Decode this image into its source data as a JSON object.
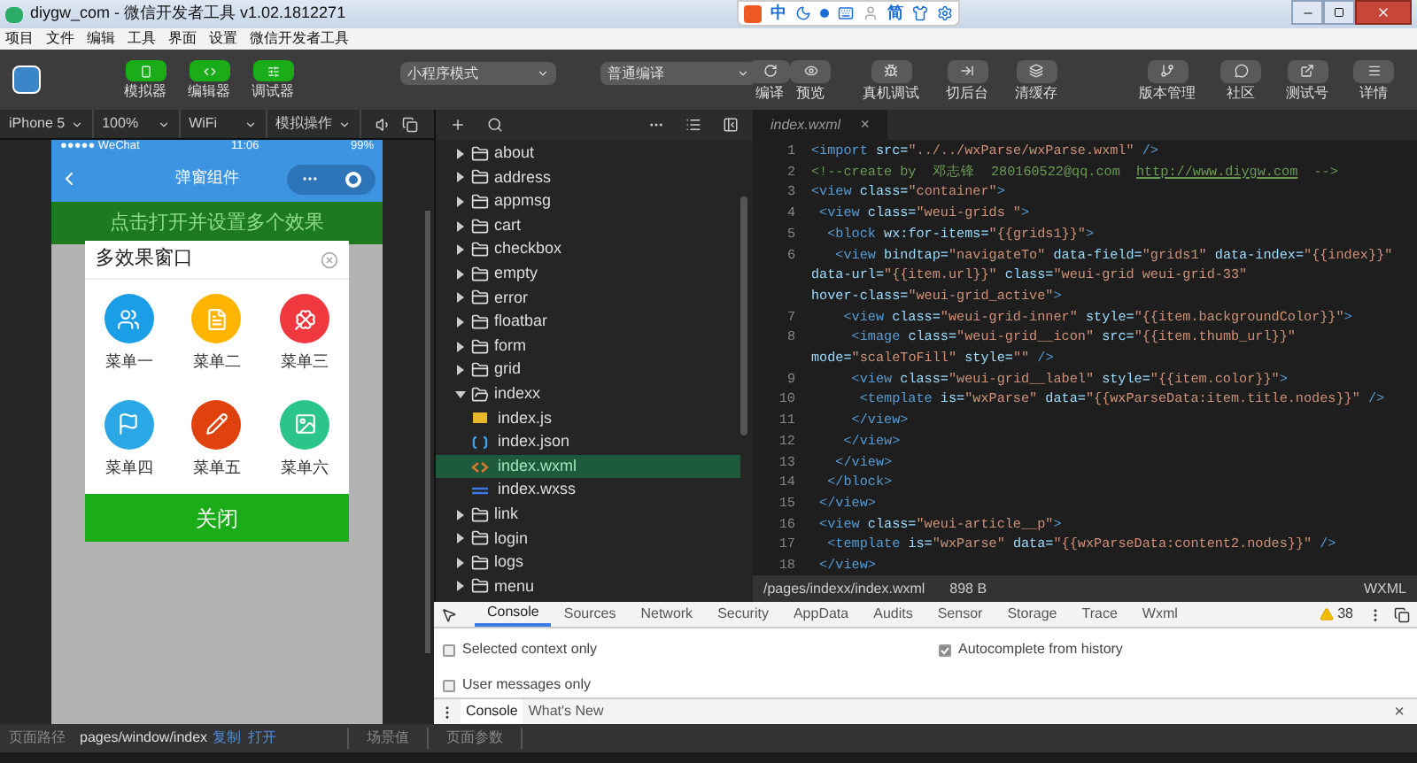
{
  "title_bar": {
    "title": "diygw_com - 微信开发者工具 v1.02.1812271"
  },
  "ime_toolbar": {
    "mode": "中",
    "script": "简"
  },
  "menu_bar": [
    "项目",
    "文件",
    "编辑",
    "工具",
    "界面",
    "设置",
    "微信开发者工具"
  ],
  "toolbar": {
    "views": [
      {
        "label": "模拟器",
        "kind": "simulator"
      },
      {
        "label": "编辑器",
        "kind": "editor"
      },
      {
        "label": "调试器",
        "kind": "debugger"
      }
    ],
    "mode_select": "小程序模式",
    "compile_select": "普通编译",
    "actions": [
      {
        "label": "编译",
        "kind": "compile"
      },
      {
        "label": "预览",
        "kind": "preview"
      },
      {
        "label": "真机调试",
        "kind": "device"
      },
      {
        "label": "切后台",
        "kind": "background"
      },
      {
        "label": "清缓存",
        "kind": "cache"
      }
    ],
    "right_actions": [
      {
        "label": "版本管理",
        "kind": "version"
      },
      {
        "label": "社区",
        "kind": "community"
      },
      {
        "label": "测试号",
        "kind": "testid"
      },
      {
        "label": "详情",
        "kind": "details"
      }
    ]
  },
  "simulator": {
    "device": "iPhone 5",
    "zoom": "100%",
    "network": "WiFi",
    "operation": "模拟操作",
    "status_bar": {
      "carrier": "●●●●● WeChat",
      "time": "11:06",
      "battery": "99%"
    },
    "nav_title": "弹窗组件",
    "banner": "点击打开并设置多个效果",
    "modal": {
      "title": "多效果窗口",
      "items": [
        {
          "label": "菜单一",
          "color": "#1a9ee8",
          "kind": "people"
        },
        {
          "label": "菜单二",
          "color": "#ffb400",
          "kind": "note"
        },
        {
          "label": "菜单三",
          "color": "#f0393f",
          "kind": "clover"
        },
        {
          "label": "菜单四",
          "color": "#29a8e5",
          "kind": "flag"
        },
        {
          "label": "菜单五",
          "color": "#e0420e",
          "kind": "pen"
        },
        {
          "label": "菜单六",
          "color": "#2bc48a",
          "kind": "image"
        }
      ],
      "close_button": "关闭"
    }
  },
  "file_tree": [
    {
      "name": "about",
      "kind": "folder",
      "expanded": false,
      "selected": false
    },
    {
      "name": "address",
      "kind": "folder",
      "expanded": false,
      "selected": false
    },
    {
      "name": "appmsg",
      "kind": "folder",
      "expanded": false,
      "selected": false
    },
    {
      "name": "cart",
      "kind": "folder",
      "expanded": false,
      "selected": false
    },
    {
      "name": "checkbox",
      "kind": "folder",
      "expanded": false,
      "selected": false
    },
    {
      "name": "empty",
      "kind": "folder",
      "expanded": false,
      "selected": false
    },
    {
      "name": "error",
      "kind": "folder",
      "expanded": false,
      "selected": false
    },
    {
      "name": "floatbar",
      "kind": "folder",
      "expanded": false,
      "selected": false
    },
    {
      "name": "form",
      "kind": "folder",
      "expanded": false,
      "selected": false
    },
    {
      "name": "grid",
      "kind": "folder",
      "expanded": false,
      "selected": false
    },
    {
      "name": "indexx",
      "kind": "folder",
      "expanded": true,
      "selected": false,
      "children": [
        {
          "name": "index.js",
          "kind": "js",
          "selected": false
        },
        {
          "name": "index.json",
          "kind": "json",
          "selected": false
        },
        {
          "name": "index.wxml",
          "kind": "wxml",
          "selected": true
        },
        {
          "name": "index.wxss",
          "kind": "wxss",
          "selected": false
        }
      ]
    },
    {
      "name": "link",
      "kind": "folder",
      "expanded": false,
      "selected": false
    },
    {
      "name": "login",
      "kind": "folder",
      "expanded": false,
      "selected": false
    },
    {
      "name": "logs",
      "kind": "folder",
      "expanded": false,
      "selected": false
    },
    {
      "name": "menu",
      "kind": "folder",
      "expanded": false,
      "selected": false
    }
  ],
  "editor": {
    "tab": "index.wxml",
    "tab_close": "×",
    "lines": [
      {
        "number": "1",
        "tokens": [
          {
            "kind": "tag",
            "text": "<import"
          },
          {
            "kind": "attr",
            "text": " src="
          },
          {
            "kind": "string",
            "text": "\"../../wxParse/wxParse.wxml\""
          },
          {
            "kind": "tag",
            "text": " />"
          }
        ]
      },
      {
        "number": "2",
        "tokens": [
          {
            "kind": "comment",
            "text": "<!--create by  邓志锋  280160522@qq.com  "
          },
          {
            "kind": "link",
            "text": "http://www.diygw.com"
          },
          {
            "kind": "comment",
            "text": "  -->"
          }
        ]
      },
      {
        "number": "3",
        "tokens": [
          {
            "kind": "tag",
            "text": "<view"
          },
          {
            "kind": "attr",
            "text": " class="
          },
          {
            "kind": "string",
            "text": "\"container\""
          },
          {
            "kind": "tag",
            "text": ">"
          }
        ]
      },
      {
        "number": "4",
        "tokens": [
          {
            "kind": "tag",
            "text": " <view"
          },
          {
            "kind": "attr",
            "text": " class="
          },
          {
            "kind": "string",
            "text": "\"weui-grids \""
          },
          {
            "kind": "tag",
            "text": ">"
          }
        ]
      },
      {
        "number": "5",
        "tokens": [
          {
            "kind": "tag",
            "text": "  <block"
          },
          {
            "kind": "attr",
            "text": " wx:for-items="
          },
          {
            "kind": "string",
            "text": "\"{{grids1}}\""
          },
          {
            "kind": "tag",
            "text": ">"
          }
        ]
      },
      {
        "number": "6",
        "tokens": [
          {
            "kind": "tag",
            "text": "   <view"
          },
          {
            "kind": "attr",
            "text": " bindtap="
          },
          {
            "kind": "string",
            "text": "\"navigateTo\""
          },
          {
            "kind": "attr",
            "text": " data-field="
          },
          {
            "kind": "string",
            "text": "\"grids1\""
          },
          {
            "kind": "attr",
            "text": " data-index="
          },
          {
            "kind": "string",
            "text": "\"{{index}}\""
          }
        ]
      },
      {
        "tokens": [
          {
            "kind": "attr",
            "text": "data-url="
          },
          {
            "kind": "string",
            "text": "\"{{item.url}}\""
          },
          {
            "kind": "attr",
            "text": " class="
          },
          {
            "kind": "string",
            "text": "\"weui-grid weui-grid-33\""
          }
        ]
      },
      {
        "tokens": [
          {
            "kind": "attr",
            "text": "hover-class="
          },
          {
            "kind": "string",
            "text": "\"weui-grid_active\""
          },
          {
            "kind": "tag",
            "text": ">"
          }
        ]
      },
      {
        "number": "7",
        "tokens": [
          {
            "kind": "tag",
            "text": "    <view"
          },
          {
            "kind": "attr",
            "text": " class="
          },
          {
            "kind": "string",
            "text": "\"weui-grid-inner\""
          },
          {
            "kind": "attr",
            "text": " style="
          },
          {
            "kind": "string",
            "text": "\"{{item.backgroundColor}}\""
          },
          {
            "kind": "tag",
            "text": ">"
          }
        ]
      },
      {
        "number": "8",
        "tokens": [
          {
            "kind": "tag",
            "text": "     <image"
          },
          {
            "kind": "attr",
            "text": " class="
          },
          {
            "kind": "string",
            "text": "\"weui-grid__icon\""
          },
          {
            "kind": "attr",
            "text": " src="
          },
          {
            "kind": "string",
            "text": "\"{{item.thumb_url}}\""
          }
        ]
      },
      {
        "tokens": [
          {
            "kind": "attr",
            "text": "mode="
          },
          {
            "kind": "string",
            "text": "\"scaleToFill\""
          },
          {
            "kind": "attr",
            "text": " style="
          },
          {
            "kind": "string",
            "text": "\"\""
          },
          {
            "kind": "tag",
            "text": " />"
          }
        ]
      },
      {
        "number": "9",
        "tokens": [
          {
            "kind": "tag",
            "text": "     <view"
          },
          {
            "kind": "attr",
            "text": " class="
          },
          {
            "kind": "string",
            "text": "\"weui-grid__label\""
          },
          {
            "kind": "attr",
            "text": " style="
          },
          {
            "kind": "string",
            "text": "\"{{item.color}}\""
          },
          {
            "kind": "tag",
            "text": ">"
          }
        ]
      },
      {
        "number": "10",
        "tokens": [
          {
            "kind": "tag",
            "text": "      <template"
          },
          {
            "kind": "attr",
            "text": " is="
          },
          {
            "kind": "string",
            "text": "\"wxParse\""
          },
          {
            "kind": "attr",
            "text": " data="
          },
          {
            "kind": "string",
            "text": "\"{{wxParseData:item.title.nodes}}\""
          },
          {
            "kind": "tag",
            "text": " />"
          }
        ]
      },
      {
        "number": "11",
        "tokens": [
          {
            "kind": "tag",
            "text": "     </view>"
          }
        ]
      },
      {
        "number": "12",
        "tokens": [
          {
            "kind": "tag",
            "text": "    </view>"
          }
        ]
      },
      {
        "number": "13",
        "tokens": [
          {
            "kind": "tag",
            "text": "   </view>"
          }
        ]
      },
      {
        "number": "14",
        "tokens": [
          {
            "kind": "tag",
            "text": "  </block>"
          }
        ]
      },
      {
        "number": "15",
        "tokens": [
          {
            "kind": "tag",
            "text": " </view>"
          }
        ]
      },
      {
        "number": "16",
        "tokens": [
          {
            "kind": "tag",
            "text": " <view"
          },
          {
            "kind": "attr",
            "text": " class="
          },
          {
            "kind": "string",
            "text": "\"weui-article__p\""
          },
          {
            "kind": "tag",
            "text": ">"
          }
        ]
      },
      {
        "number": "17",
        "tokens": [
          {
            "kind": "tag",
            "text": "  <template"
          },
          {
            "kind": "attr",
            "text": " is="
          },
          {
            "kind": "string",
            "text": "\"wxParse\""
          },
          {
            "kind": "attr",
            "text": " data="
          },
          {
            "kind": "string",
            "text": "\"{{wxParseData:content2.nodes}}\""
          },
          {
            "kind": "tag",
            "text": " />"
          }
        ]
      },
      {
        "number": "18",
        "tokens": [
          {
            "kind": "tag",
            "text": " </view>"
          }
        ]
      }
    ],
    "status": {
      "path": "/pages/indexx/index.wxml",
      "size": "898 B",
      "language": "WXML"
    }
  },
  "devtools": {
    "tabs": [
      {
        "label": "Console",
        "selected": true
      },
      {
        "label": "Sources",
        "selected": false
      },
      {
        "label": "Network",
        "selected": false
      },
      {
        "label": "Security",
        "selected": false
      },
      {
        "label": "AppData",
        "selected": false
      },
      {
        "label": "Audits",
        "selected": false
      },
      {
        "label": "Sensor",
        "selected": false
      },
      {
        "label": "Storage",
        "selected": false
      },
      {
        "label": "Trace",
        "selected": false
      },
      {
        "label": "Wxml",
        "selected": false
      }
    ],
    "warnings": "38",
    "options": [
      {
        "label": "Selected context only",
        "checked": false
      },
      {
        "label": "Autocomplete from history",
        "checked": true
      },
      {
        "label": "User messages only",
        "checked": false
      }
    ],
    "drawer_tabs": [
      {
        "label": "Console",
        "selected": true
      },
      {
        "label": "What's New",
        "selected": false
      }
    ],
    "drawer_close": "×"
  },
  "bottom_bar": {
    "path_label": "页面路径",
    "path": "pages/window/index",
    "copy": "复制",
    "open": "打开",
    "scene": "场景值",
    "params": "页面参数"
  }
}
